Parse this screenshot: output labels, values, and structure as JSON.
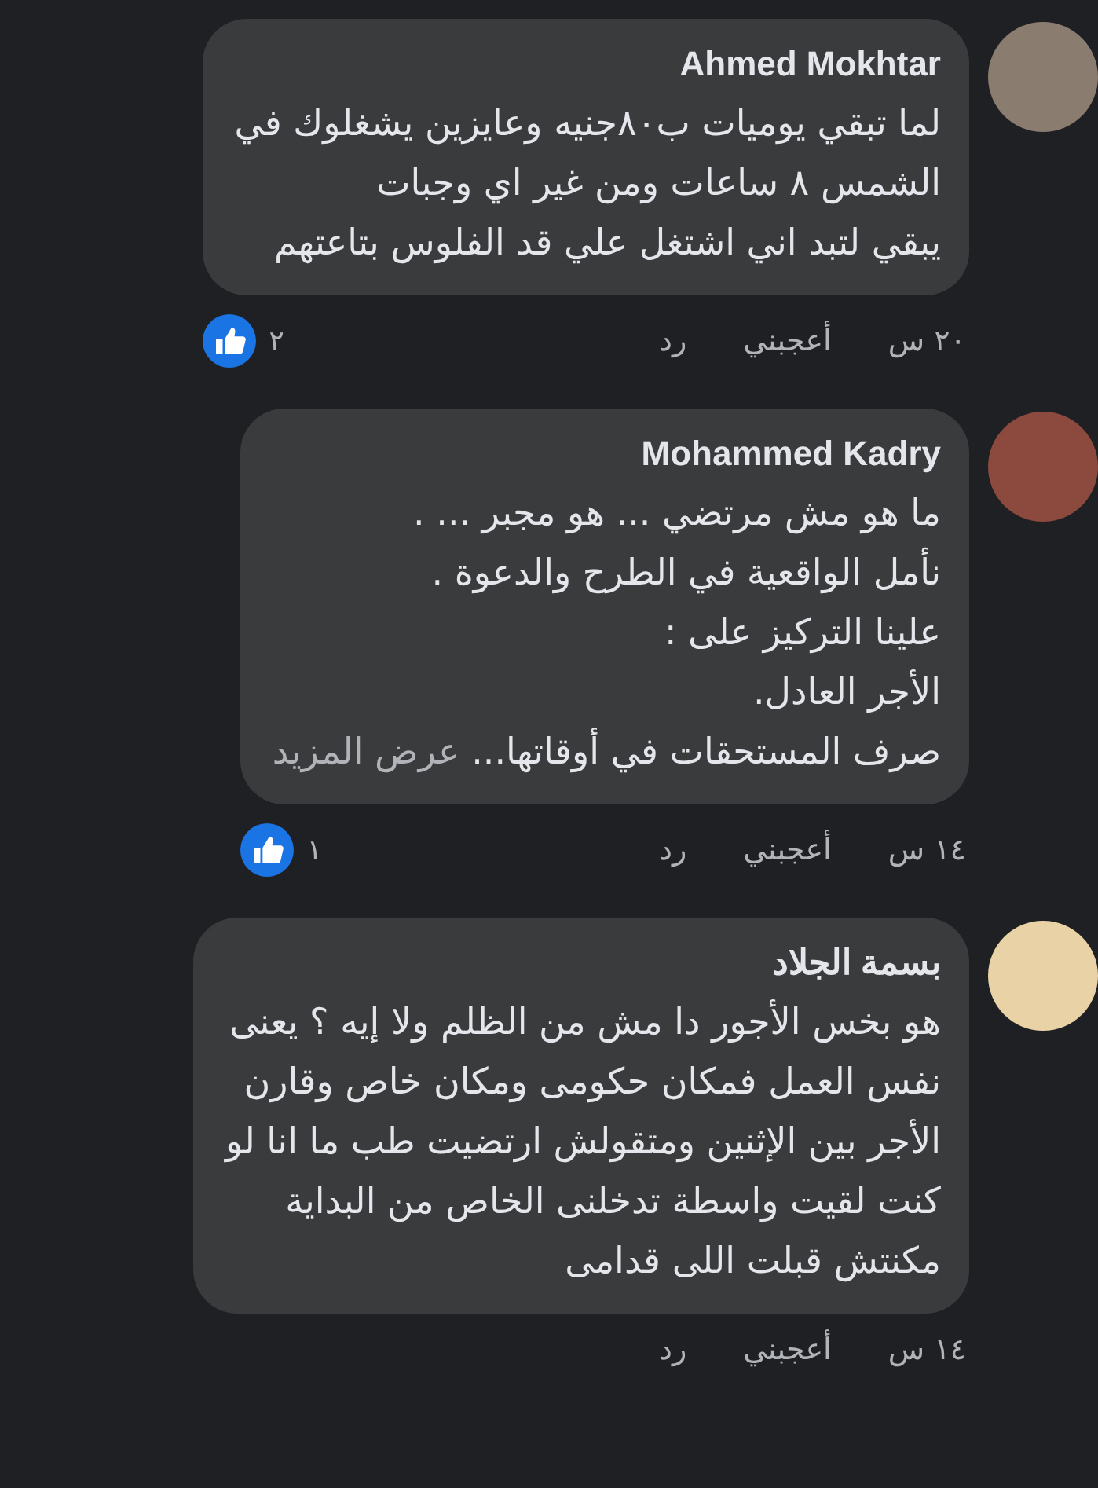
{
  "comments": [
    {
      "author": "Ahmed Mokhtar",
      "lines": [
        "لما تبقي يوميات ب٨٠جنيه وعايزين يشغلوك في",
        "الشمس ٨ ساعات ومن غير اي وجبات",
        "يبقي لتبد اني اشتغل علي قد الفلوس بتاعتهم"
      ],
      "time": "٢٠ س",
      "like": "أعجبني",
      "reply": "رد",
      "reactions": {
        "count": "٢"
      }
    },
    {
      "author": "Mohammed Kadry",
      "lines": [
        "ما هو مش مرتضي ... هو مجبر ... .",
        "نأمل الواقعية في الطرح والدعوة .",
        "علينا التركيز على :",
        "الأجر العادل.",
        "صرف المستحقات في أوقاتها..."
      ],
      "see_more": "عرض المزيد",
      "time": "١٤ س",
      "like": "أعجبني",
      "reply": "رد",
      "reactions": {
        "count": "١"
      }
    },
    {
      "author": "بسمة الجلاد",
      "lines": [
        "هو بخس الأجور دا مش من الظلم ولا إيه ؟ يعنى",
        "نفس العمل فمكان حكومى ومكان خاص وقارن",
        "الأجر بين الإثنين ومتقولش ارتضيت طب ما انا لو",
        "كنت لقيت واسطة تدخلنى الخاص من البداية",
        "مكنتش قبلت اللى قدامى"
      ],
      "time": "١٤ س",
      "like": "أعجبني",
      "reply": "رد"
    }
  ]
}
